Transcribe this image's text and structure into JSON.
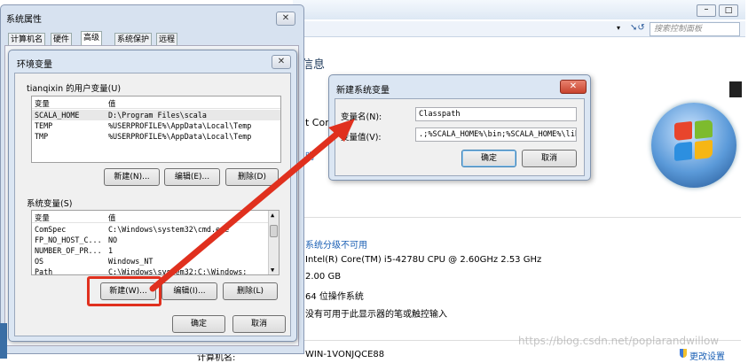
{
  "bg_panel": {
    "search_placeholder": "搜索控制面板",
    "heading": "信息",
    "corp_fragment": "t Corp",
    "link_fragment": "明",
    "rating": "系统分级不可用",
    "cpu": "Intel(R) Core(TM) i5-4278U CPU @ 2.60GHz   2.53 GHz",
    "ram": "2.00 GB",
    "systype": "64 位操作系统",
    "pen": "没有可用于此显示器的笔或触控输入",
    "computer_name_label": "计算机名:",
    "computer_name": "WIN-1VONJQCE88",
    "change_settings": "更改设置"
  },
  "sysprops": {
    "title": "系统属性",
    "tabs": [
      "计算机名",
      "硬件",
      "高级",
      "系统保护",
      "远程"
    ],
    "active_tab": "高级"
  },
  "envvars": {
    "title": "环境变量",
    "user_section": "tianqixin 的用户变量(U)",
    "col_var": "变量",
    "col_val": "值",
    "user_rows": [
      {
        "name": "SCALA_HOME",
        "value": "D:\\Program Files\\scala"
      },
      {
        "name": "TEMP",
        "value": "%USERPROFILE%\\AppData\\Local\\Temp"
      },
      {
        "name": "TMP",
        "value": "%USERPROFILE%\\AppData\\Local\\Temp"
      }
    ],
    "user_new": "新建(N)...",
    "user_edit": "编辑(E)...",
    "user_delete": "删除(D)",
    "sys_section": "系统变量(S)",
    "sys_rows": [
      {
        "name": "ComSpec",
        "value": "C:\\Windows\\system32\\cmd.exe"
      },
      {
        "name": "FP_NO_HOST_C...",
        "value": "NO"
      },
      {
        "name": "NUMBER_OF_PR...",
        "value": "1"
      },
      {
        "name": "OS",
        "value": "Windows_NT"
      },
      {
        "name": "Path",
        "value": "C:\\Windows\\system32;C:\\Windows;"
      }
    ],
    "sys_new": "新建(W)...",
    "sys_edit": "编辑(I)...",
    "sys_delete": "删除(L)",
    "ok": "确定",
    "cancel": "取消"
  },
  "newvar": {
    "title": "新建系统变量",
    "name_label": "变量名(N):",
    "name_value": "Classpath",
    "value_label": "变量值(V):",
    "value_value": ".;%SCALA_HOME%\\bin;%SCALA_HOME%\\lib\\",
    "ok": "确定",
    "cancel": "取消"
  },
  "watermark": "https://blog.csdn.net/poplarandwillow",
  "colors": {
    "highlight": "#e0301e",
    "link": "#1a5fb4",
    "title_bar": "#dce7f4"
  }
}
